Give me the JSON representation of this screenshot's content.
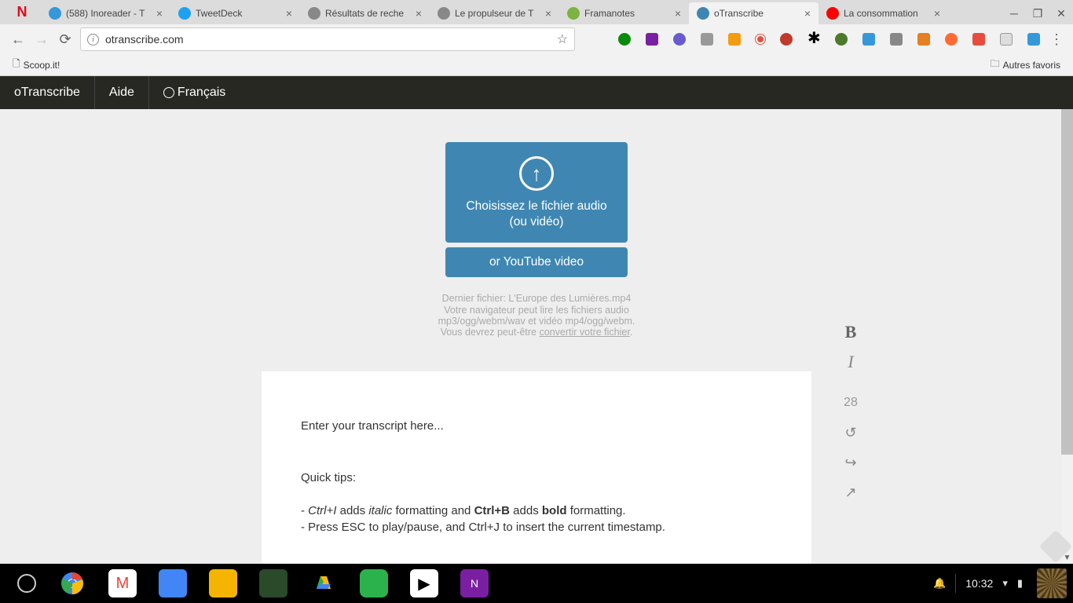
{
  "browser": {
    "tabs": [
      {
        "title": "(588) Inoreader - T",
        "favcolor": "#3498db"
      },
      {
        "title": "TweetDeck",
        "favcolor": "#1da1f2"
      },
      {
        "title": "Résultats de reche",
        "favcolor": "#888"
      },
      {
        "title": "Le propulseur de T",
        "favcolor": "#888"
      },
      {
        "title": "Framanotes",
        "favcolor": "#7cb342"
      },
      {
        "title": "oTranscribe",
        "favcolor": "#3f87b2",
        "active": true
      },
      {
        "title": "La consommation",
        "favcolor": "#ff0000"
      }
    ],
    "url": "otranscribe.com",
    "bookmarks": {
      "scoop": "Scoop.it!",
      "other": "Autres favoris"
    }
  },
  "app": {
    "brand": "oTranscribe",
    "help": "Aide",
    "lang": "Français",
    "upload_label": "Choisissez le fichier audio (ou vidéo)",
    "youtube_label": "or YouTube video",
    "last_file_prefix": "Dernier fichier: ",
    "last_file": "L'Europe des Lumières.mp4",
    "format_hint1": "Votre navigateur peut lire les fichiers audio mp3/ogg/webm/wav et vidéo mp4/ogg/webm.",
    "format_hint2a": "Vous devrez peut-être ",
    "format_hint2b": "convertir votre fichier",
    "format_hint2c": ".",
    "editor": {
      "placeholder": "Enter your transcript here...",
      "quicktips": "Quick tips:",
      "tip1_a": "- ",
      "tip1_b": "Ctrl+I",
      "tip1_c": " adds ",
      "tip1_d": "italic",
      "tip1_e": " formatting and ",
      "tip1_f": "Ctrl+B",
      "tip1_g": " adds ",
      "tip1_h": "bold",
      "tip1_i": " formatting.",
      "tip2": "- Press ESC to play/pause, and Ctrl+J to insert the current timestamp."
    },
    "side": {
      "bold": "B",
      "italic": "I",
      "count": "28",
      "undo": "↺",
      "redo": "↪",
      "share": "↗"
    }
  },
  "taskbar": {
    "clock": "10:32"
  }
}
